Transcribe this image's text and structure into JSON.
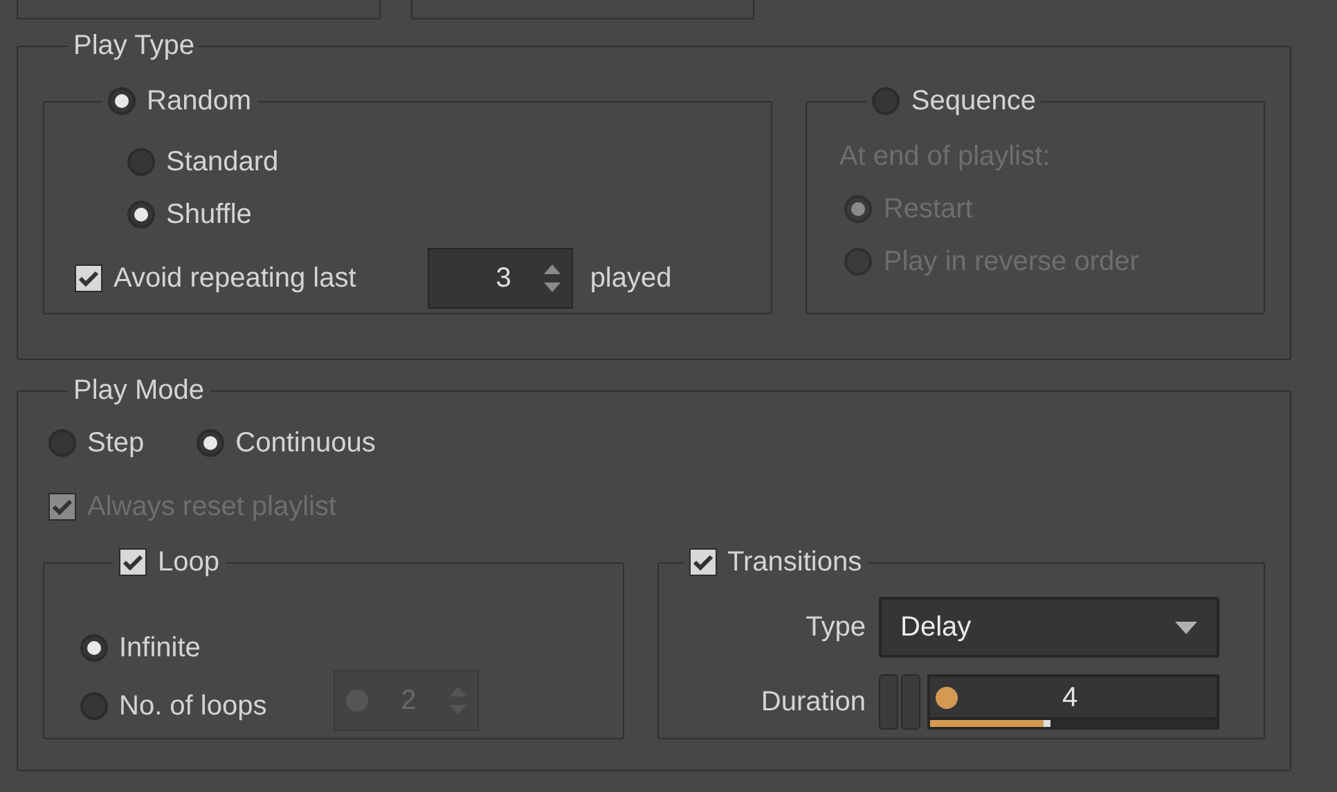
{
  "play_type": {
    "title": "Play Type",
    "random": {
      "label": "Random",
      "selected": true,
      "options": [
        {
          "label": "Standard",
          "selected": false
        },
        {
          "label": "Shuffle",
          "selected": true
        }
      ],
      "avoid": {
        "label": "Avoid repeating last",
        "checked": true,
        "value": "3",
        "suffix": "played"
      }
    },
    "sequence": {
      "label": "Sequence",
      "selected": false,
      "disabled": true,
      "caption": "At end of playlist:",
      "options": [
        {
          "label": "Restart",
          "selected": true
        },
        {
          "label": "Play in reverse order",
          "selected": false
        }
      ]
    }
  },
  "play_mode": {
    "title": "Play Mode",
    "modes": [
      {
        "label": "Step",
        "selected": false
      },
      {
        "label": "Continuous",
        "selected": true
      }
    ],
    "reset": {
      "label": "Always reset playlist",
      "checked": true,
      "disabled": true
    },
    "loop": {
      "label": "Loop",
      "checked": true,
      "options": [
        {
          "label": "Infinite",
          "selected": true
        },
        {
          "label": "No. of loops",
          "selected": false
        }
      ],
      "count": {
        "value": "2",
        "disabled": true
      }
    },
    "transitions": {
      "label": "Transitions",
      "checked": true,
      "type_label": "Type",
      "type_value": "Delay",
      "duration_label": "Duration",
      "duration_value": "4",
      "level": 0.4
    }
  }
}
